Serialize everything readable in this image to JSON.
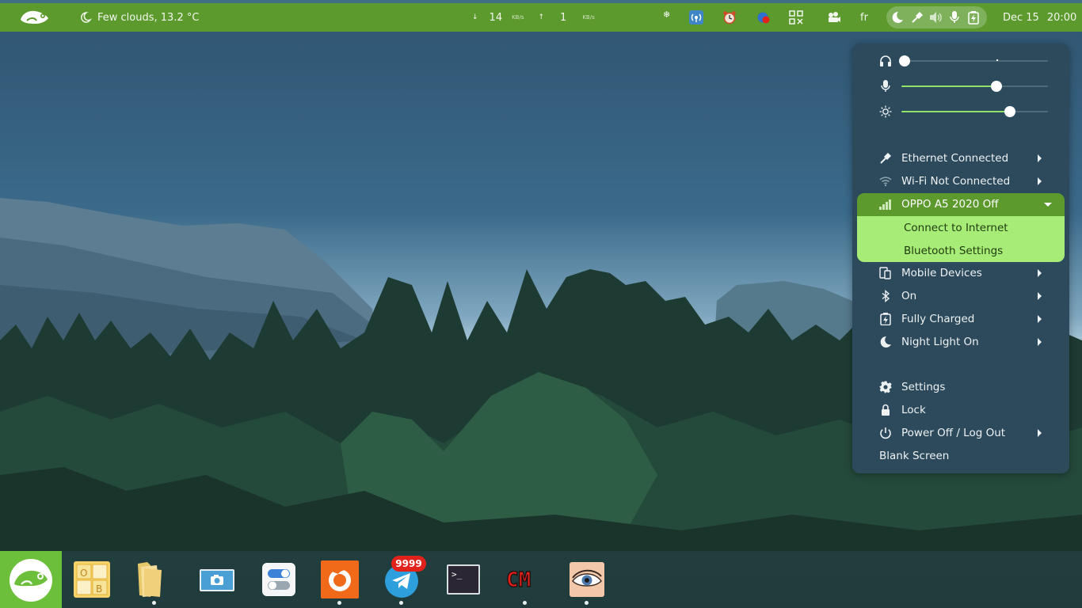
{
  "topbar": {
    "weather": "Few clouds, 13.2 °C",
    "download_value": "14",
    "download_unit": "KB/s",
    "upload_value": "1",
    "upload_unit": "KB/s",
    "language": "fr",
    "date": "Dec 15",
    "time": "20:00",
    "tray_icons": [
      "snowflake-icon",
      "wireless-icon",
      "alarm-clock-icon",
      "badge-icon",
      "qr-icon",
      "extension-icon"
    ],
    "status_icons": [
      "night-light-icon",
      "ethernet-icon",
      "volume-icon",
      "microphone-icon",
      "battery-charging-icon"
    ]
  },
  "menu": {
    "sliders": [
      {
        "name": "headphones",
        "icon": "headphones-icon",
        "value": 0.02
      },
      {
        "name": "microphone",
        "icon": "microphone-icon",
        "value": 0.65
      },
      {
        "name": "brightness",
        "icon": "brightness-icon",
        "value": 0.74
      }
    ],
    "ethernet": "Ethernet Connected",
    "wifi": "Wi-Fi Not Connected",
    "phone": "OPPO A5 2020 Off",
    "connect_internet": "Connect to Internet",
    "bluetooth_settings": "Bluetooth Settings",
    "mobile_devices": "Mobile Devices",
    "bluetooth": "On",
    "battery": "Fully Charged",
    "night_light": "Night Light On",
    "settings": "Settings",
    "lock": "Lock",
    "power": "Power Off / Log Out",
    "blank_screen": "Blank Screen"
  },
  "dock": {
    "items": [
      "opensuse-start",
      "libreoffice-base",
      "files",
      "screenshot",
      "settings-toggle",
      "firefox",
      "telegram",
      "terminal",
      "cm-app",
      "eye-app"
    ],
    "telegram_badge": "9999",
    "office_icon_text": [
      "O",
      "B"
    ],
    "terminal_prompt": ">_",
    "cm_text": "CM"
  },
  "colors": {
    "bar": "#5c9a2d",
    "menu_bg": "#2c4a5c",
    "accent": "#8fe36a",
    "submenu": "#a6ec76"
  }
}
